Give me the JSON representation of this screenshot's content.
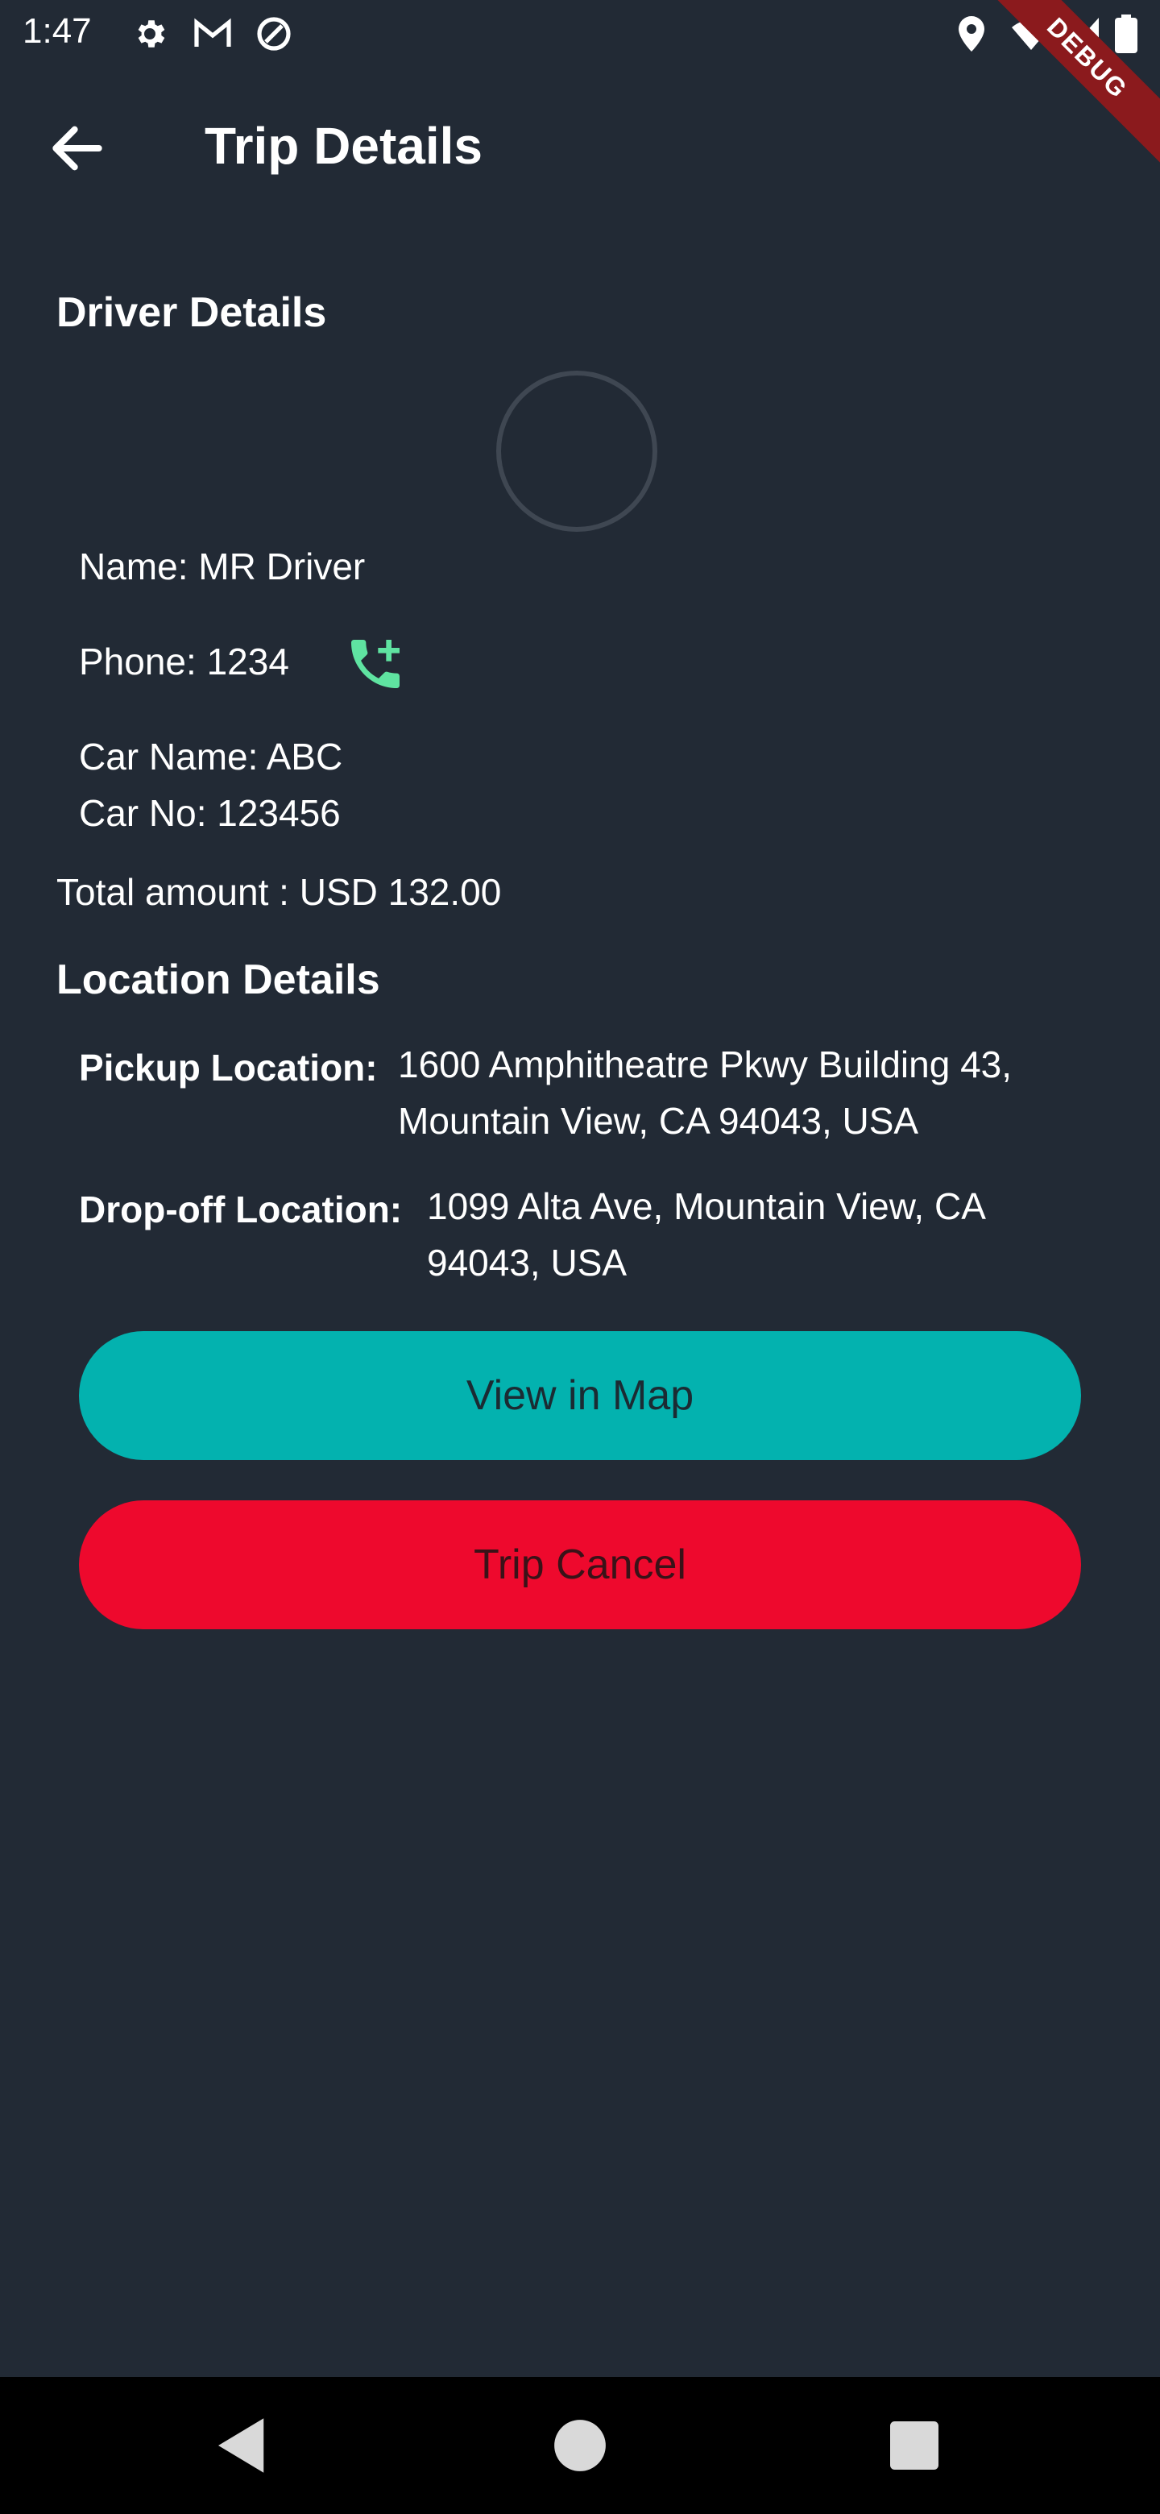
{
  "status_bar": {
    "time": "1:47",
    "icons": [
      "gear-icon",
      "gmail-icon",
      "data-saver-icon",
      "location-icon",
      "wifi-icon",
      "signal-icon",
      "battery-icon"
    ],
    "debug_label": "DEBUG"
  },
  "app_bar": {
    "title": "Trip Details",
    "back_icon": "arrow-back-icon"
  },
  "driver": {
    "section_title": "Driver Details",
    "name": "Name: MR Driver",
    "phone": "Phone: 1234",
    "car_name": "Car Name: ABC",
    "car_no": "Car No: 123456",
    "call_icon": "add-call-icon"
  },
  "total_amount": "Total amount : USD 132.00",
  "location": {
    "section_title": "Location Details",
    "pickup_label": "Pickup Location:",
    "pickup_value": "1600 Amphitheatre Pkwy Building 43, Mountain View, CA 94043, USA",
    "dropoff_label": "Drop-off Location:",
    "dropoff_value": "1099 Alta Ave, Mountain View, CA 94043, USA"
  },
  "buttons": {
    "view_map": "View in Map",
    "trip_cancel": "Trip Cancel"
  },
  "colors": {
    "background": "#222a35",
    "accent_teal": "#03b2af",
    "cancel_red": "#ee092d",
    "call_green": "#5fe3a1"
  },
  "nav_bar": {
    "icons": [
      "nav-back-icon",
      "nav-home-icon",
      "nav-recents-icon"
    ]
  }
}
